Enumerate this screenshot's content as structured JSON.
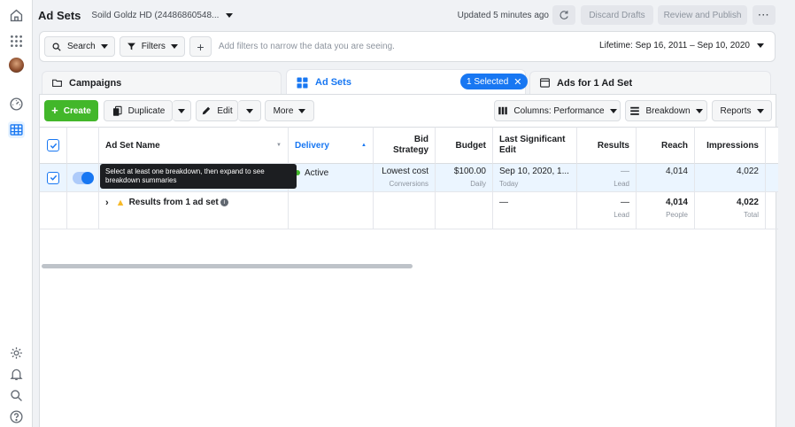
{
  "header": {
    "title": "Ad Sets",
    "account": "Soild Goldz HD (24486860548...",
    "updated": "Updated 5 minutes ago",
    "discard_label": "Discard Drafts",
    "review_label": "Review and Publish",
    "more_label": "···"
  },
  "filterbar": {
    "search_label": "Search",
    "filters_label": "Filters",
    "plus_label": "+",
    "hint": "Add filters to narrow the data you are seeing.",
    "lifetime": "Lifetime: Sep 16, 2011 – Sep 10, 2020"
  },
  "tabs": {
    "campaigns": "Campaigns",
    "adsets": "Ad Sets",
    "selected": "1 Selected",
    "ads": "Ads for 1 Ad Set"
  },
  "toolbar": {
    "create": "Create",
    "duplicate": "Duplicate",
    "edit": "Edit",
    "more": "More",
    "columns": "Columns: Performance",
    "breakdown": "Breakdown",
    "reports": "Reports"
  },
  "table": {
    "headers": {
      "name": "Ad Set Name",
      "delivery": "Delivery",
      "bid_strategy": "Bid Strategy",
      "budget": "Budget",
      "last_edit": "Last Significant Edit",
      "results": "Results",
      "reach": "Reach",
      "impressions": "Impressions"
    },
    "row1": {
      "delivery": "Active",
      "bid": "Lowest cost",
      "bid_sub": "Conversions",
      "budget": "$100.00",
      "budget_sub": "Daily",
      "last_edit": "Sep 10, 2020, 1...",
      "last_edit_sub": "Today",
      "results": "—",
      "results_sub": "Lead",
      "reach": "4,014",
      "impressions": "4,022"
    },
    "summary": {
      "label": "Results from 1 ad set",
      "last_edit": "—",
      "results": "—",
      "results_sub": "Lead",
      "reach": "4,014",
      "reach_sub": "People",
      "impressions": "4,022",
      "impressions_sub": "Total"
    }
  },
  "tooltip": "Select at least one breakdown, then expand to see breakdown summaries",
  "colors": {
    "accent": "#1877f2",
    "create_green": "#42b72a",
    "active_green": "#42b72a",
    "warning": "#f7b928"
  }
}
